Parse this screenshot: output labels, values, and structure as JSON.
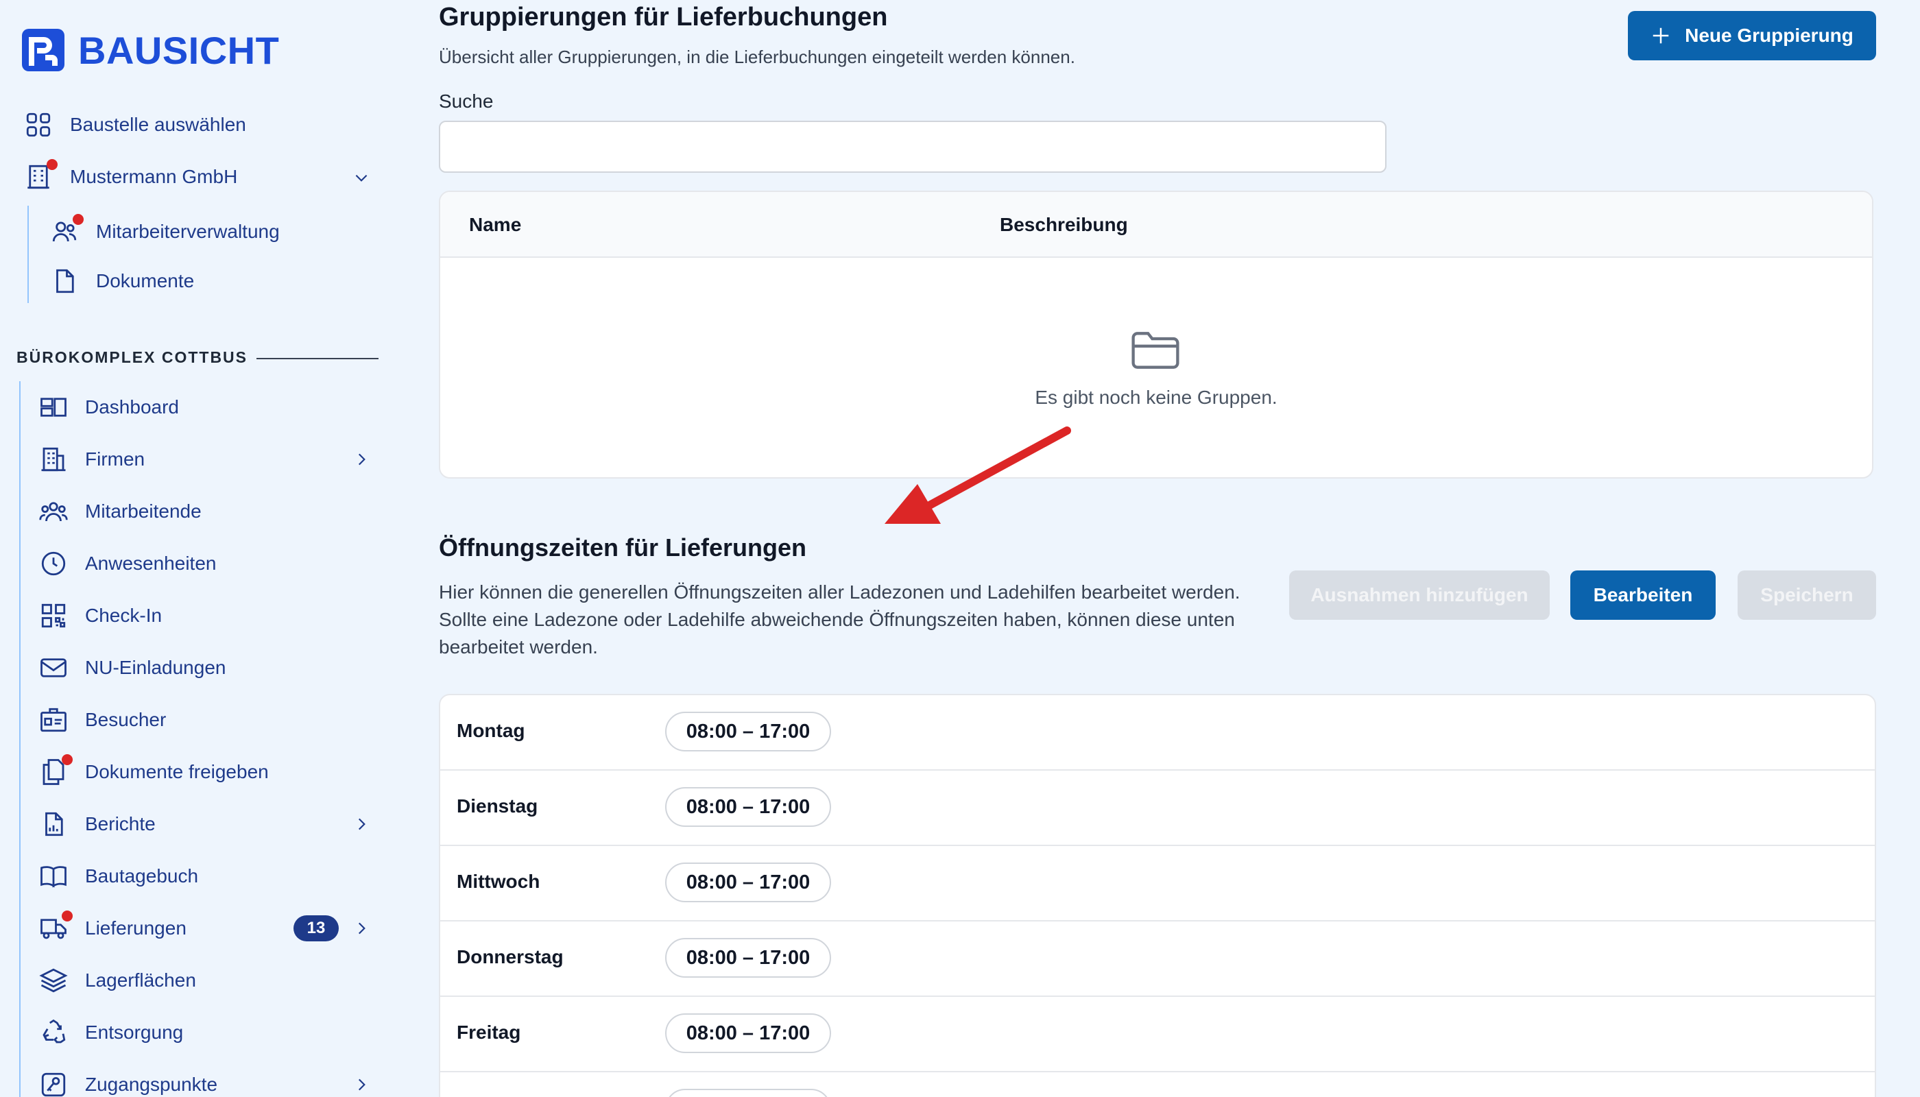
{
  "brand": {
    "name": "BAUSICHT",
    "color": "#1d4ed8"
  },
  "colors": {
    "primary": "#0b63ad",
    "nav": "#1e3a8a",
    "alert": "#dc2626",
    "annotation_arrow": "#dc2626"
  },
  "sidebar": {
    "top_items": [
      {
        "label": "Baustelle auswählen",
        "icon": "grid-icon"
      },
      {
        "label": "Mustermann GmbH",
        "icon": "building-icon",
        "has_dot": true,
        "chevron": "down"
      }
    ],
    "company_sub_items": [
      {
        "label": "Mitarbeiterverwaltung",
        "icon": "users-icon",
        "has_dot": true
      },
      {
        "label": "Dokumente",
        "icon": "document-icon"
      }
    ],
    "section_title": "BÜROKOMPLEX COTTBUS",
    "site_items": [
      {
        "label": "Dashboard",
        "icon": "dashboard-icon"
      },
      {
        "label": "Firmen",
        "icon": "office-building-icon",
        "chevron": "right"
      },
      {
        "label": "Mitarbeitende",
        "icon": "user-group-icon"
      },
      {
        "label": "Anwesenheiten",
        "icon": "clock-icon"
      },
      {
        "label": "Check-In",
        "icon": "qr-code-icon"
      },
      {
        "label": "NU-Einladungen",
        "icon": "envelope-icon"
      },
      {
        "label": "Besucher",
        "icon": "id-card-icon"
      },
      {
        "label": "Dokumente freigeben",
        "icon": "documents-icon",
        "has_dot": true
      },
      {
        "label": "Berichte",
        "icon": "report-icon",
        "chevron": "right"
      },
      {
        "label": "Bautagebuch",
        "icon": "book-icon"
      },
      {
        "label": "Lieferungen",
        "icon": "truck-icon",
        "has_dot": true,
        "badge": "13",
        "chevron": "right"
      },
      {
        "label": "Lagerflächen",
        "icon": "layers-icon"
      },
      {
        "label": "Entsorgung",
        "icon": "recycle-icon"
      },
      {
        "label": "Zugangspunkte",
        "icon": "key-icon",
        "chevron": "right"
      }
    ]
  },
  "groups": {
    "title": "Gruppierungen für Lieferbuchungen",
    "subtitle": "Übersicht aller Gruppierungen, in die Lieferbuchungen eingeteilt werden können.",
    "new_button": "Neue Gruppierung",
    "search_label": "Suche",
    "search_value": "",
    "columns": [
      "Name",
      "Beschreibung"
    ],
    "empty_text": "Es gibt noch keine Gruppen."
  },
  "hours": {
    "title": "Öffnungszeiten für Lieferungen",
    "description": "Hier können die generellen Öffnungszeiten aller Ladezonen und Ladehilfen bearbeitet werden. Sollte eine Ladezone oder Ladehilfe abweichende Öffnungszeiten haben, können diese unten bearbeitet werden.",
    "buttons": {
      "exceptions": "Ausnahmen hinzufügen",
      "edit": "Bearbeiten",
      "save": "Speichern"
    },
    "days": [
      {
        "day": "Montag",
        "time": "08:00 – 17:00"
      },
      {
        "day": "Dienstag",
        "time": "08:00 – 17:00"
      },
      {
        "day": "Mittwoch",
        "time": "08:00 – 17:00"
      },
      {
        "day": "Donnerstag",
        "time": "08:00 – 17:00"
      },
      {
        "day": "Freitag",
        "time": "08:00 – 17:00"
      },
      {
        "day": "",
        "time": ""
      }
    ]
  }
}
